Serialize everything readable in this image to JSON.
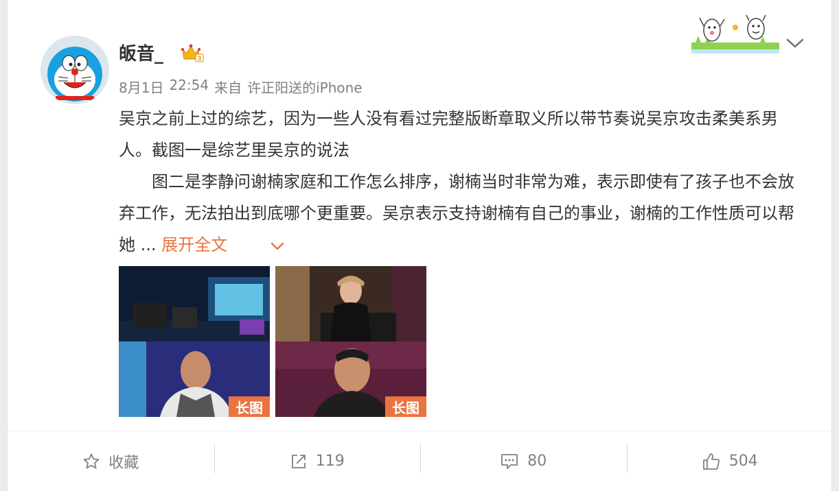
{
  "post": {
    "username": "皈音_",
    "date": "8月1日",
    "time": "22:54",
    "source_prefix": "来自",
    "source": "许正阳送的iPhone",
    "paragraph1": "吴京之前上过的综艺，因为一些人没有看过完整版断章取义所以带节奏说吴京攻击柔美系男人。截图一是综艺里吴京的说法",
    "paragraph2": "图二是李静问谢楠家庭和工作怎么排序，谢楠当时非常为难，表示即使有了孩子也不会放弃工作，无法拍出到底哪个更重要。吴京表示支持谢楠有自己的事业，谢楠的工作性质可以帮她 ...",
    "expand_label": "展开全文",
    "images": [
      {
        "badge": "长图"
      },
      {
        "badge": "长图"
      }
    ]
  },
  "actions": {
    "favorite_label": "收藏",
    "repost_count": "119",
    "comment_count": "80",
    "like_count": "504"
  },
  "icons": {
    "favorite": "star-icon",
    "repost": "share-icon",
    "comment": "comment-icon",
    "like": "thumbs-up-icon",
    "menu": "chevron-down-icon"
  },
  "colors": {
    "accent": "#eb7340",
    "text": "#333333",
    "meta": "#808080"
  }
}
